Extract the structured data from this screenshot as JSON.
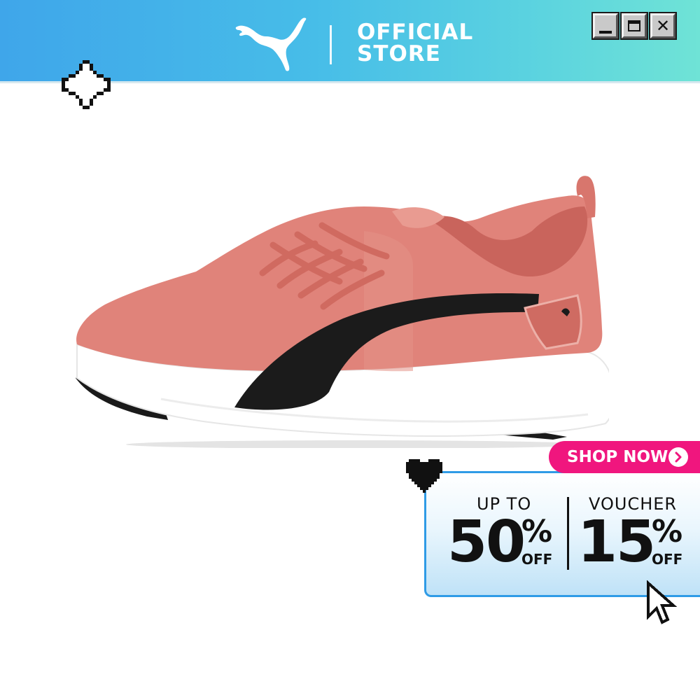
{
  "header": {
    "brand_icon": "puma-cat-logo-icon",
    "store_line1": "OFFICIAL",
    "store_line2": "STORE",
    "gradient_start": "#3fa6ea",
    "gradient_end": "#6fe3d6"
  },
  "window_controls": {
    "minimize_icon": "minimize-icon",
    "maximize_icon": "maximize-icon",
    "close_label": "✕"
  },
  "decorations": {
    "sparkle_icon": "sparkle-icon",
    "heart_icon": "pixel-heart-icon",
    "cursor_icon": "pixel-cursor-icon"
  },
  "product": {
    "image": "pink-running-shoe",
    "colors": {
      "upper": "#e0837a",
      "stripe": "#1b1b1b",
      "sole": "#ffffff"
    }
  },
  "promo": {
    "shop_now_label": "SHOP NOW",
    "shop_now_color": "#f0167e",
    "arrow_icon": "chevron-right-icon",
    "left_caption": "UP TO",
    "left_value": "50",
    "left_percent": "%",
    "left_off": "OFF",
    "right_caption": "VOUCHER",
    "right_value": "15",
    "right_percent": "%",
    "right_off": "OFF",
    "border_color": "#2f9be6"
  }
}
